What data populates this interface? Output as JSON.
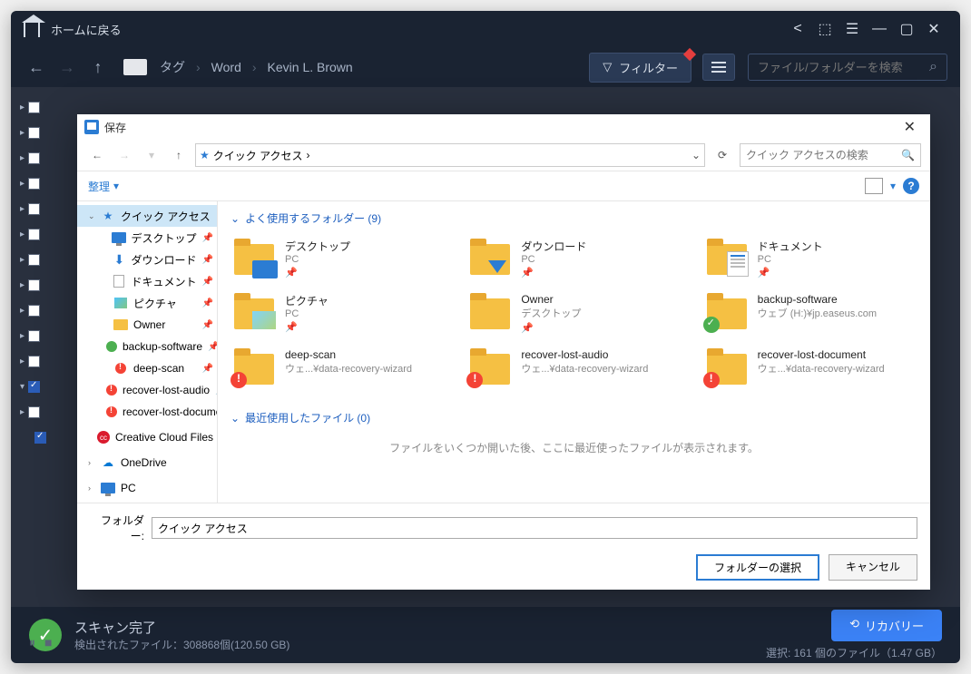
{
  "titlebar": {
    "home": "ホームに戻る"
  },
  "toolbar": {
    "tag": "タグ",
    "crumbs": [
      "Word",
      "Kevin L. Brown"
    ],
    "filter": "フィルター",
    "search_placeholder": "ファイル/フォルダーを検索"
  },
  "status": {
    "title": "スキャン完了",
    "detail": "検出されたファイル：308868個(120.50 GB)",
    "recovery": "リカバリー",
    "selection": "選択: 161 個のファイル（1.47 GB）"
  },
  "dialog": {
    "title": "保存",
    "path": "クイック アクセス",
    "search_placeholder": "クイック アクセスの検索",
    "organize": "整理",
    "sidebar": [
      {
        "label": "クイック アクセス",
        "ico": "star",
        "sel": true,
        "caret": true,
        "pin": false
      },
      {
        "label": "デスクトップ",
        "ico": "monitor",
        "pin": true
      },
      {
        "label": "ダウンロード",
        "ico": "dl",
        "pin": true
      },
      {
        "label": "ドキュメント",
        "ico": "doc",
        "pin": true
      },
      {
        "label": "ピクチャ",
        "ico": "pic",
        "pin": true
      },
      {
        "label": "Owner",
        "ico": "folder",
        "pin": true
      },
      {
        "label": "backup-software",
        "ico": "green",
        "pin": true
      },
      {
        "label": "deep-scan",
        "ico": "red",
        "pin": true
      },
      {
        "label": "recover-lost-audio",
        "ico": "red",
        "pin": true
      },
      {
        "label": "recover-lost-document",
        "ico": "red",
        "pin": true
      },
      {
        "label": "Creative Cloud Files",
        "ico": "cc",
        "pin": false
      },
      {
        "label": "OneDrive",
        "ico": "od",
        "caret": true,
        "pin": false
      },
      {
        "label": "PC",
        "ico": "monitor",
        "caret": true,
        "pin": false
      }
    ],
    "section_folders": "よく使用するフォルダー (9)",
    "folders": [
      {
        "name": "デスクトップ",
        "sub": "PC",
        "ov": "monitor",
        "pin": true
      },
      {
        "name": "ダウンロード",
        "sub": "PC",
        "ov": "arrow",
        "pin": true
      },
      {
        "name": "ドキュメント",
        "sub": "PC",
        "ov": "doc",
        "pin": true
      },
      {
        "name": "ピクチャ",
        "sub": "PC",
        "ov": "pic",
        "pin": true
      },
      {
        "name": "Owner",
        "sub": "デスクトップ",
        "ov": "",
        "pin": true
      },
      {
        "name": "backup-software",
        "sub": "ウェブ (H:)¥jp.easeus.com",
        "ov": "green",
        "pin": false
      },
      {
        "name": "deep-scan",
        "sub": "ウェ...¥data-recovery-wizard",
        "ov": "red",
        "pin": false
      },
      {
        "name": "recover-lost-audio",
        "sub": "ウェ...¥data-recovery-wizard",
        "ov": "red",
        "pin": false
      },
      {
        "name": "recover-lost-document",
        "sub": "ウェ...¥data-recovery-wizard",
        "ov": "red",
        "pin": false
      }
    ],
    "section_recent": "最近使用したファイル (0)",
    "recent_msg": "ファイルをいくつか開いた後、ここに最近使ったファイルが表示されます。",
    "folder_label": "フォルダー:",
    "folder_value": "クイック アクセス",
    "select_btn": "フォルダーの選択",
    "cancel_btn": "キャンセル"
  }
}
